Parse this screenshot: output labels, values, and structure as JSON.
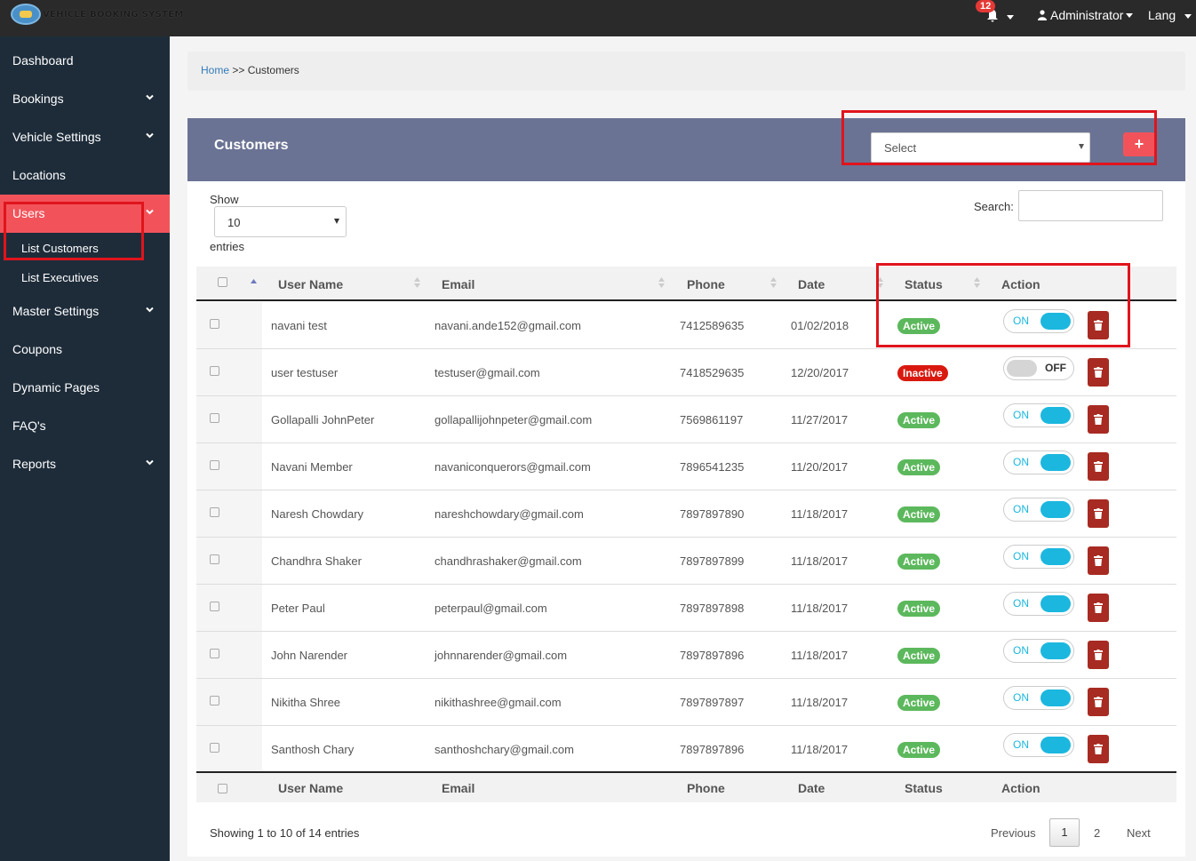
{
  "app": {
    "title": "VEHICLE BOOKING SYSTEM",
    "notification_count": "12",
    "user_label": "Administrator",
    "lang_label": "Lang"
  },
  "sidebar": {
    "items": [
      {
        "label": "Dashboard",
        "has_children": false
      },
      {
        "label": "Bookings",
        "has_children": true
      },
      {
        "label": "Vehicle Settings",
        "has_children": true
      },
      {
        "label": "Locations",
        "has_children": false
      },
      {
        "label": "Users",
        "has_children": true,
        "active": true
      },
      {
        "label": "Master Settings",
        "has_children": true
      },
      {
        "label": "Coupons",
        "has_children": false
      },
      {
        "label": "Dynamic Pages",
        "has_children": false
      },
      {
        "label": "FAQ's",
        "has_children": false
      },
      {
        "label": "Reports",
        "has_children": true
      }
    ],
    "users_sub": [
      {
        "label": "List Customers",
        "active": true
      },
      {
        "label": "List Executives"
      }
    ]
  },
  "breadcrumb": {
    "home": "Home",
    "sep": ">>",
    "current": "Customers"
  },
  "panel": {
    "title": "Customers",
    "select_placeholder": "Select",
    "add_label": "+"
  },
  "table_controls": {
    "show_label": "Show",
    "page_length": "10",
    "entries_label": "entries",
    "search_label": "Search:"
  },
  "table": {
    "columns": [
      "User Name",
      "Email",
      "Phone",
      "Date",
      "Status",
      "Action"
    ],
    "rows": [
      {
        "name": "navani test",
        "email": "navani.ande152@gmail.com",
        "phone": "7412589635",
        "date": "01/02/2018",
        "status": "Active",
        "toggle": "ON"
      },
      {
        "name": "user testuser",
        "email": "testuser@gmail.com",
        "phone": "7418529635",
        "date": "12/20/2017",
        "status": "Inactive",
        "toggle": "OFF"
      },
      {
        "name": "Gollapalli JohnPeter",
        "email": "gollapallijohnpeter@gmail.com",
        "phone": "7569861197",
        "date": "11/27/2017",
        "status": "Active",
        "toggle": "ON"
      },
      {
        "name": "Navani Member",
        "email": "navaniconquerors@gmail.com",
        "phone": "7896541235",
        "date": "11/20/2017",
        "status": "Active",
        "toggle": "ON"
      },
      {
        "name": "Naresh Chowdary",
        "email": "nareshchowdary@gmail.com",
        "phone": "7897897890",
        "date": "11/18/2017",
        "status": "Active",
        "toggle": "ON"
      },
      {
        "name": "Chandhra Shaker",
        "email": "chandhrashaker@gmail.com",
        "phone": "7897897899",
        "date": "11/18/2017",
        "status": "Active",
        "toggle": "ON"
      },
      {
        "name": "Peter Paul",
        "email": "peterpaul@gmail.com",
        "phone": "7897897898",
        "date": "11/18/2017",
        "status": "Active",
        "toggle": "ON"
      },
      {
        "name": "John Narender",
        "email": "johnnarender@gmail.com",
        "phone": "7897897896",
        "date": "11/18/2017",
        "status": "Active",
        "toggle": "ON"
      },
      {
        "name": "Nikitha Shree",
        "email": "nikithashree@gmail.com",
        "phone": "7897897897",
        "date": "11/18/2017",
        "status": "Active",
        "toggle": "ON"
      },
      {
        "name": "Santhosh Chary",
        "email": "santhoshchary@gmail.com",
        "phone": "7897897896",
        "date": "11/18/2017",
        "status": "Active",
        "toggle": "ON"
      }
    ]
  },
  "footer": {
    "info": "Showing 1 to 10 of 14 entries",
    "previous": "Previous",
    "pages": [
      "1",
      "2"
    ],
    "current_page": "1",
    "next": "Next"
  },
  "colors": {
    "topbar": "#2a2a2a",
    "sidebar": "#1e2c3a",
    "active_nav": "#f2535a",
    "panel_header": "#6b7394",
    "toggle_on": "#1bb7de",
    "delete": "#a72b22",
    "active_badge": "#5cb85c",
    "inactive_badge": "#d9190f",
    "highlight": "#e0141c"
  },
  "icons": [
    "logo-icon",
    "bell-icon",
    "user-icon",
    "chevron-down-icon",
    "sort-icon",
    "trash-icon",
    "plus-icon"
  ]
}
